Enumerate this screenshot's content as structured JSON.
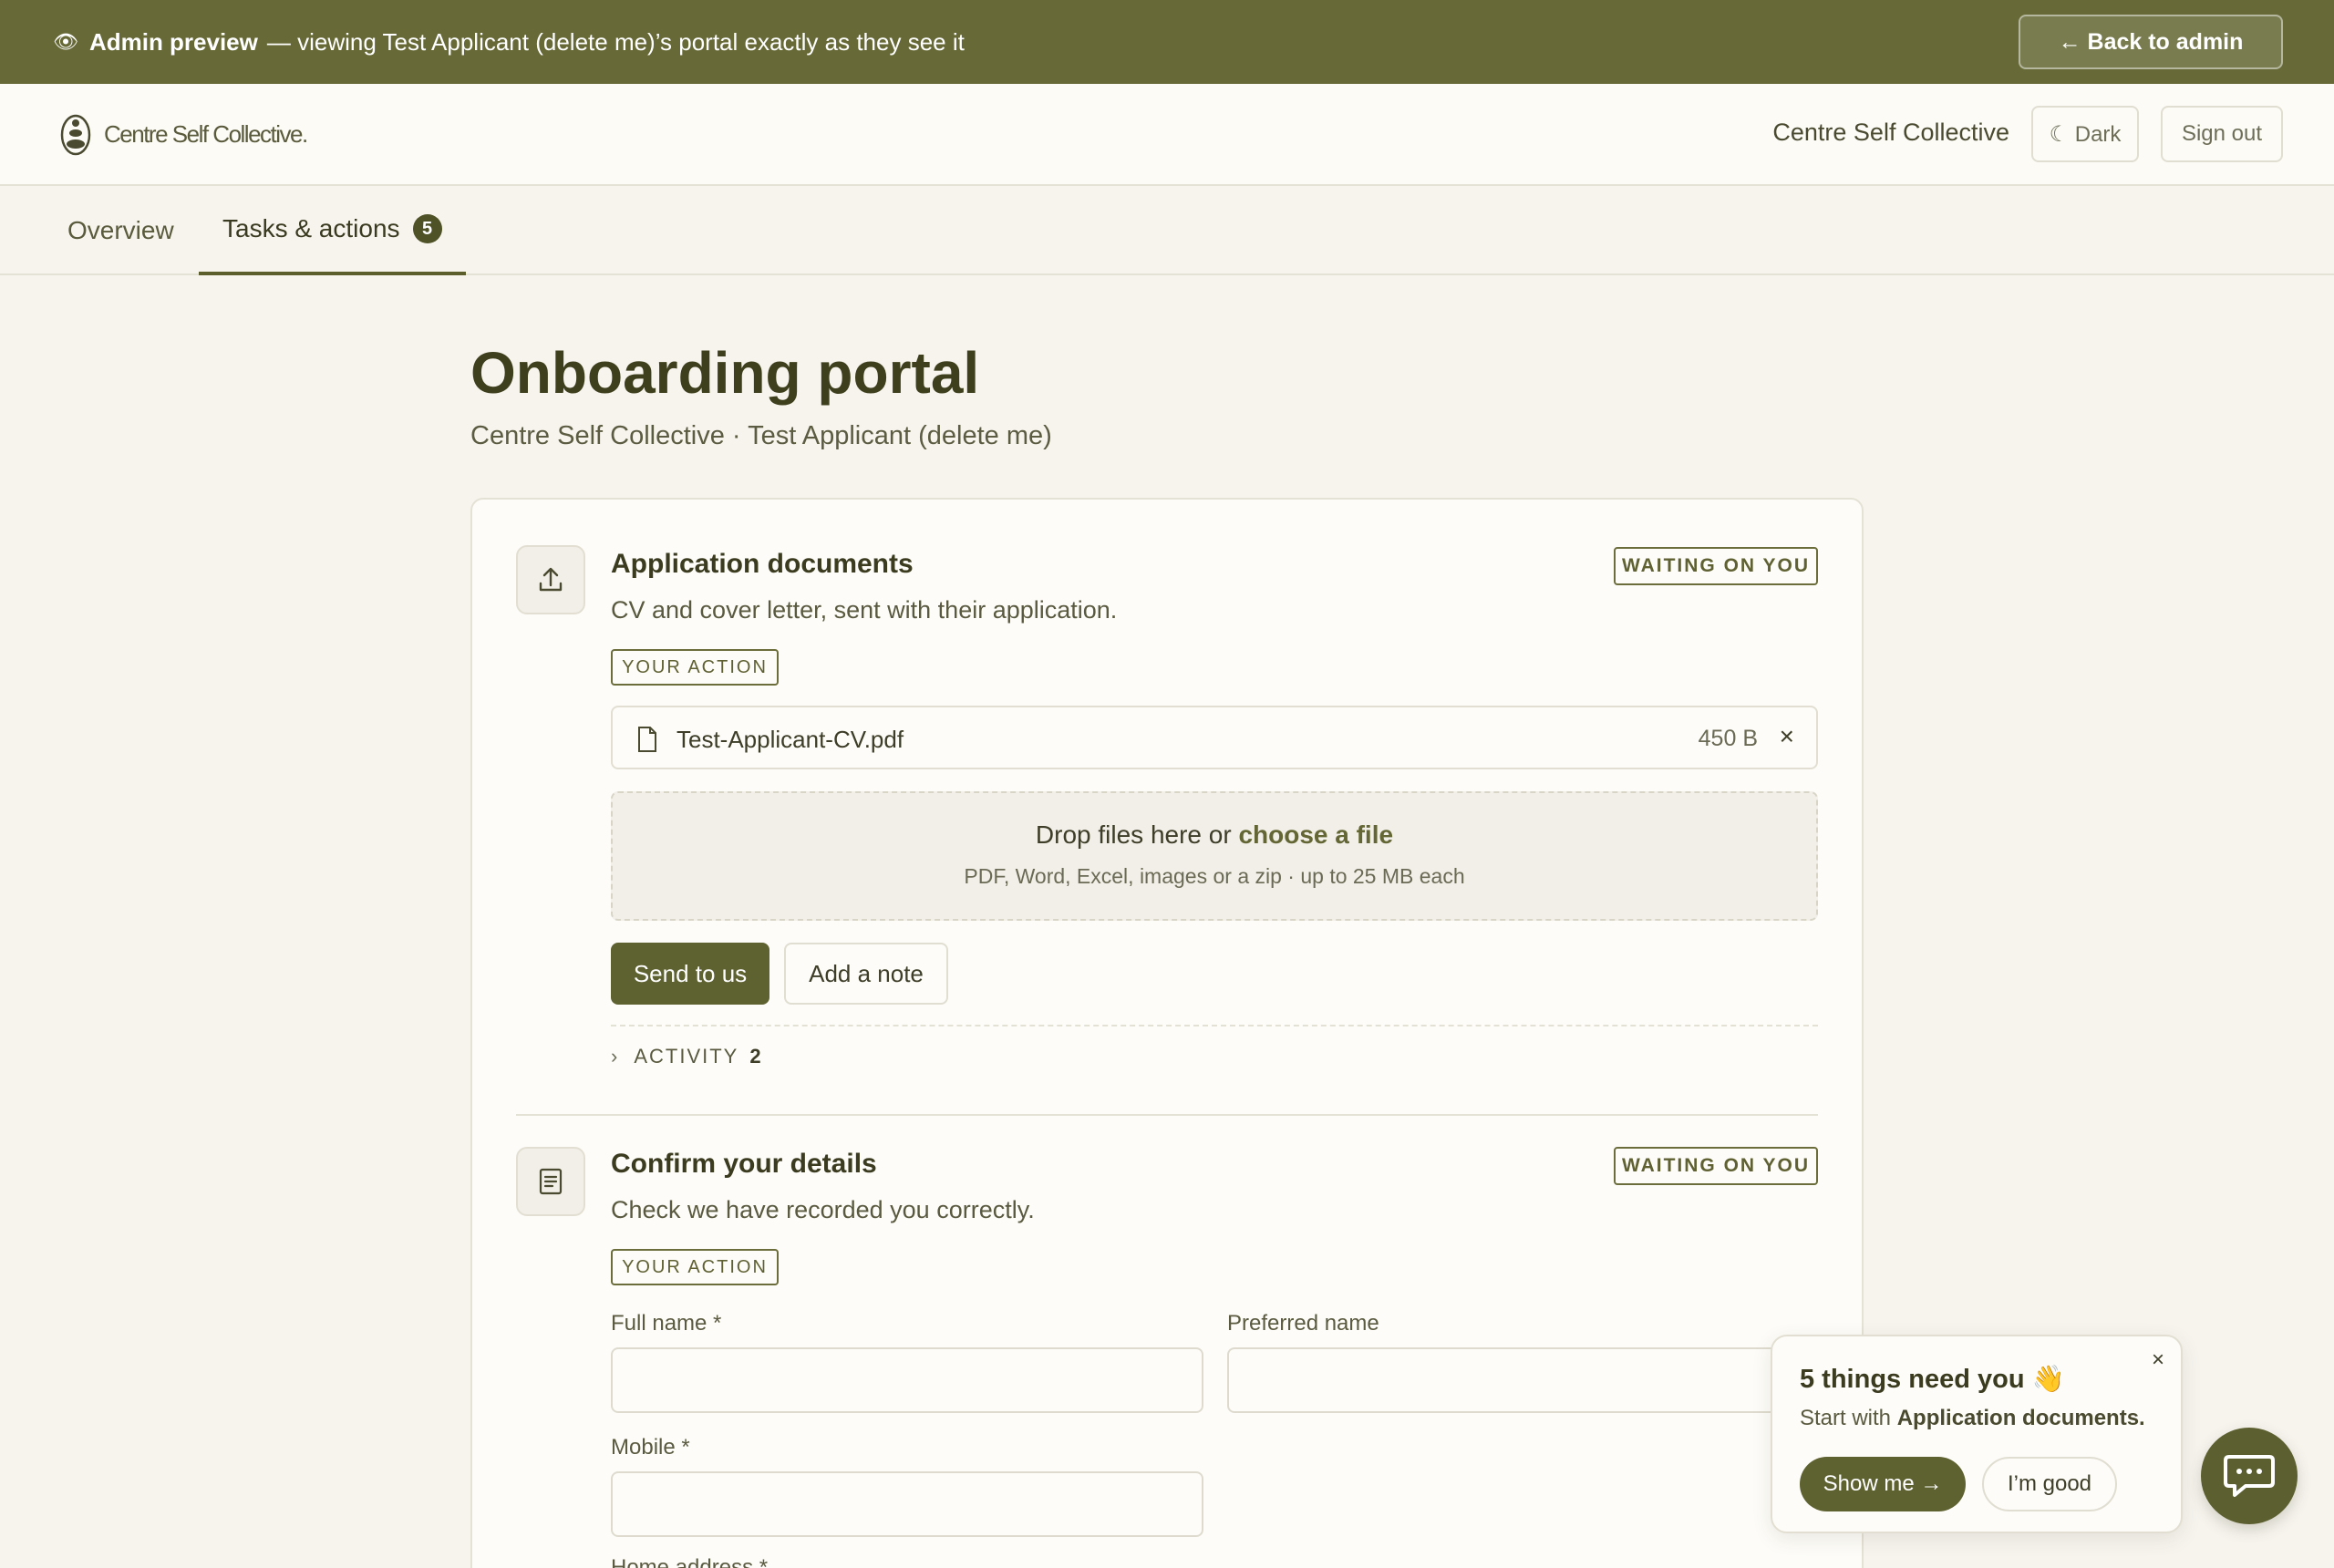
{
  "banner": {
    "eye_icon": "eye-icon",
    "label": "Admin preview",
    "text": "— viewing Test Applicant (delete me)’s portal exactly as they see it",
    "back_label": "← Back to admin"
  },
  "header": {
    "logo_text": "Centre Self Collective.",
    "org_name": "Centre Self Collective",
    "dark_label": "☾ Dark",
    "signout_label": "Sign out"
  },
  "tabs": [
    {
      "label": "Overview"
    },
    {
      "label": "Tasks & actions",
      "badge": "5"
    }
  ],
  "page": {
    "title": "Onboarding portal",
    "subtitle": "Centre Self Collective · Test Applicant (delete me)"
  },
  "tasks": [
    {
      "title": "Application documents",
      "description": "CV and cover letter, sent with their application.",
      "status": "WAITING ON YOU",
      "action_badge": "YOUR ACTION",
      "file": {
        "name": "Test-Applicant-CV.pdf",
        "size": "450 B",
        "remove": "×"
      },
      "dropzone": {
        "text": "Drop files here or ",
        "link": "choose a file",
        "hint": "PDF, Word, Excel, images or a zip · up to 25 MB each"
      },
      "send_label": "Send to us",
      "note_label": "Add a note",
      "activity_label": "ACTIVITY",
      "activity_count": "2"
    },
    {
      "title": "Confirm your details",
      "description": "Check we have recorded you correctly.",
      "status": "WAITING ON YOU",
      "action_badge": "YOUR ACTION",
      "fields": {
        "full_name": "Full name *",
        "preferred_name": "Preferred name",
        "mobile": "Mobile *",
        "home_address": "Home address *"
      }
    }
  ],
  "popup": {
    "title": "5 things need you 👋",
    "text_prefix": "Start with ",
    "text_bold": "Application documents.",
    "show_label": "Show me →",
    "good_label": "I’m good",
    "close": "×"
  },
  "colors": {
    "accent": "#676a37",
    "primary_button": "#5e6130",
    "background": "#f6f4ed"
  }
}
